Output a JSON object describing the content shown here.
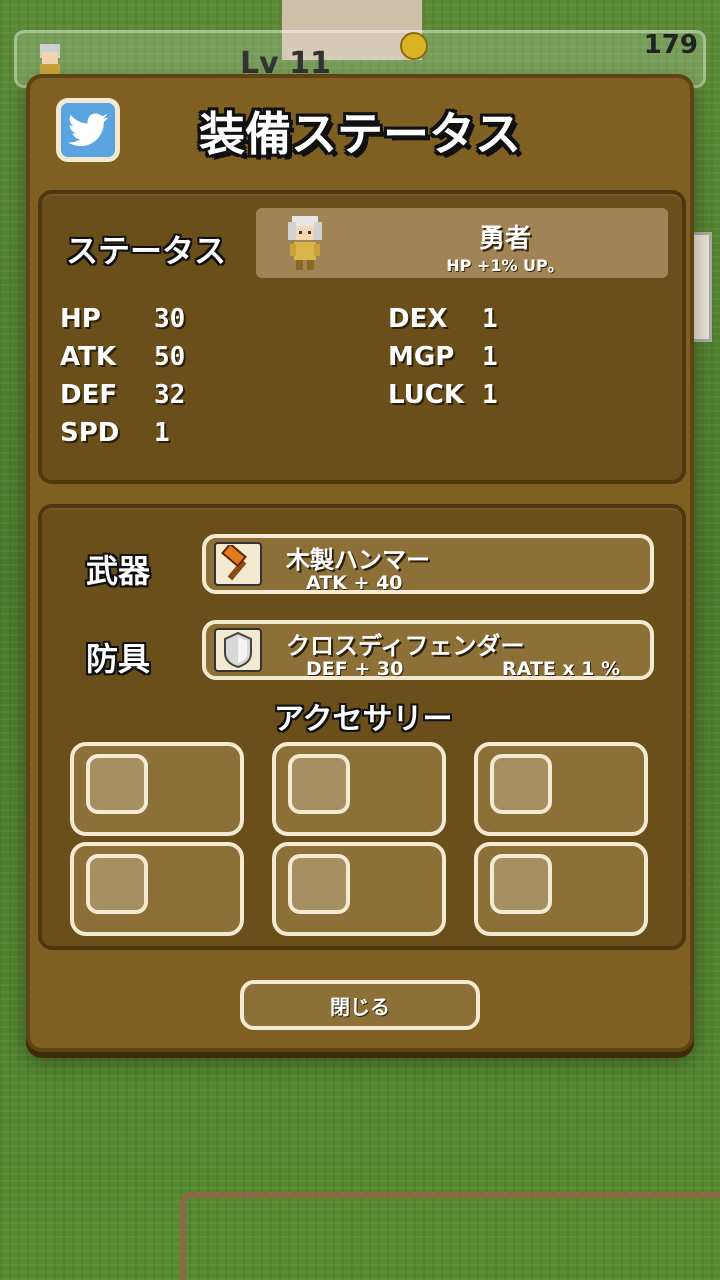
{
  "hud": {
    "gold": "179",
    "level": "Lv 11"
  },
  "header": {
    "title": "装備ステータス",
    "share_icon": "twitter-bird-icon"
  },
  "status": {
    "label": "ステータス",
    "job": {
      "name": "勇者",
      "bonus": "HP +1% UP。"
    },
    "left_stats": [
      {
        "name": "HP",
        "value": "30"
      },
      {
        "name": "ATK",
        "value": "50"
      },
      {
        "name": "DEF",
        "value": "32"
      },
      {
        "name": "SPD",
        "value": "1"
      }
    ],
    "right_stats": [
      {
        "name": "DEX",
        "value": "1"
      },
      {
        "name": "MGP",
        "value": "1"
      },
      {
        "name": "LUCK",
        "value": "1"
      }
    ]
  },
  "equipment": {
    "weapon": {
      "label": "武器",
      "name": "木製ハンマー",
      "stat": "ATK + 40",
      "icon": "hammer-icon"
    },
    "armor": {
      "label": "防具",
      "name": "クロスディフェンダー",
      "stat": "DEF + 30",
      "rate": "RATE x 1 %",
      "icon": "shield-icon"
    },
    "accessory_label": "アクセサリー",
    "accessory_slot_count": 6
  },
  "close_label": "閉じる",
  "colors": {
    "panel": "#7f5f22",
    "inner_box": "#6b4f1a",
    "slot": "#8d6f38",
    "slot_border": "#f4ead2",
    "twitter_blue": "#5aa5e0"
  }
}
